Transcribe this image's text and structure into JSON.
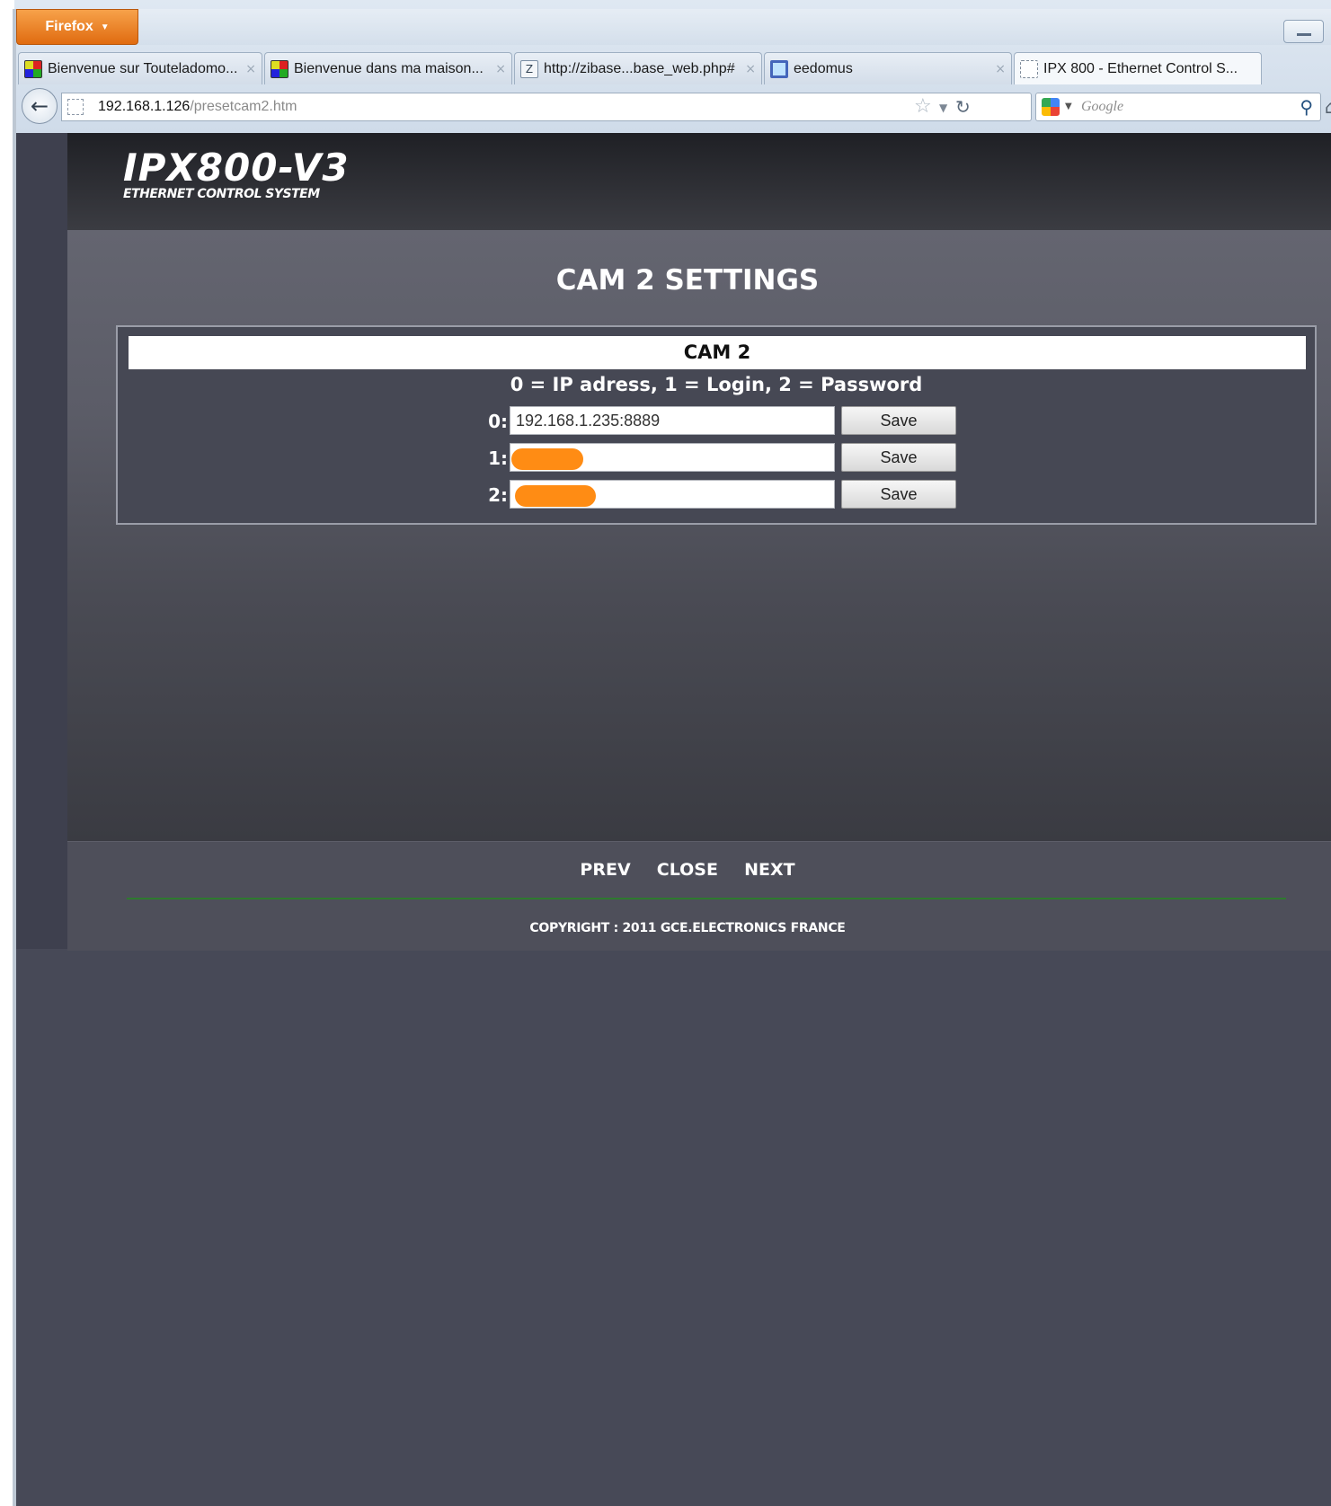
{
  "browser": {
    "menu_button": "Firefox",
    "tabs": [
      {
        "label": "Bienvenue sur Touteladomo...",
        "close": "×"
      },
      {
        "label": "Bienvenue dans ma maison...",
        "close": "×"
      },
      {
        "label": "http://zibase...base_web.php#",
        "close": "×"
      },
      {
        "label": "eedomus",
        "close": "×"
      },
      {
        "label": "IPX 800 - Ethernet Control S..."
      }
    ],
    "url_host": "192.168.1.126",
    "url_path": "/presetcam2.htm",
    "search_placeholder": "Google"
  },
  "header": {
    "logo_title": "IPX800-V3",
    "logo_subtitle": "ETHERNET CONTROL SYSTEM"
  },
  "main": {
    "page_title": "CAM 2 SETTINGS",
    "panel_title": "CAM 2",
    "legend": "0 = IP adress, 1 = Login, 2 = Password",
    "rows": [
      {
        "label": "0:",
        "value": "192.168.1.235:8889",
        "button": "Save"
      },
      {
        "label": "1:",
        "value": "",
        "button": "Save"
      },
      {
        "label": "2:",
        "value": "",
        "button": "Save"
      }
    ]
  },
  "footer": {
    "nav": {
      "prev": "PREV",
      "close": "CLOSE",
      "next": "NEXT"
    },
    "copyright": "COPYRIGHT : 2011 GCE.ELECTRONICS FRANCE"
  },
  "colors": {
    "firefox_button": "#e06b10",
    "page_background": "#474957",
    "header_background": "#1f2025",
    "redaction": "#ff8c14",
    "footer_divider": "#2e7a2e"
  },
  "icons": [
    "back-arrow-icon",
    "bookmark-star-icon",
    "reload-icon",
    "google-icon",
    "search-icon",
    "home-icon",
    "tab-close-icon"
  ]
}
